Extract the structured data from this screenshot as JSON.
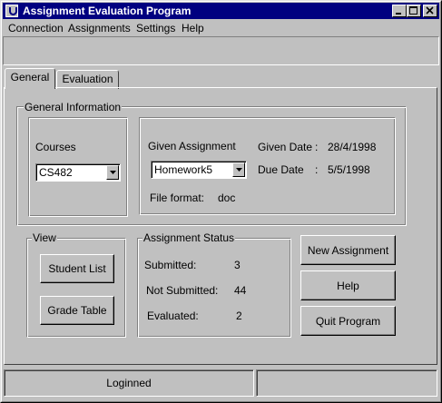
{
  "window": {
    "title": "Assignment Evaluation Program"
  },
  "menu": {
    "items": [
      "Connection",
      "Assignments",
      "Settings",
      "Help"
    ]
  },
  "tabs": [
    {
      "label": "General",
      "selected": true
    },
    {
      "label": "Evaluation",
      "selected": false
    }
  ],
  "general_info": {
    "legend": "General Information",
    "courses": {
      "label": "Courses",
      "selected": "CS482"
    },
    "assignment": {
      "label": "Given Assignment",
      "selected": "Homework5",
      "given_date_label": "Given Date",
      "given_date_sep": ":",
      "given_date": "28/4/1998",
      "due_date_label": "Due Date",
      "due_date_sep": ":",
      "due_date": "5/5/1998",
      "file_format_label": "File format:",
      "file_format": "doc"
    }
  },
  "view": {
    "legend": "View",
    "student_list_label": "Student List",
    "grade_table_label": "Grade Table"
  },
  "assignment_status": {
    "legend": "Assignment Status",
    "submitted_label": "Submitted:",
    "submitted": "3",
    "not_submitted_label": "Not Submitted:",
    "not_submitted": "44",
    "evaluated_label": "Evaluated:",
    "evaluated": "2"
  },
  "actions": {
    "new_assignment_label": "New Assignment",
    "help_label": "Help",
    "quit_label": "Quit Program"
  },
  "statusbar": {
    "message": "Loginned",
    "secondary": ""
  },
  "colors": {
    "titlebar": "#000080",
    "face": "#c0c0c0"
  }
}
